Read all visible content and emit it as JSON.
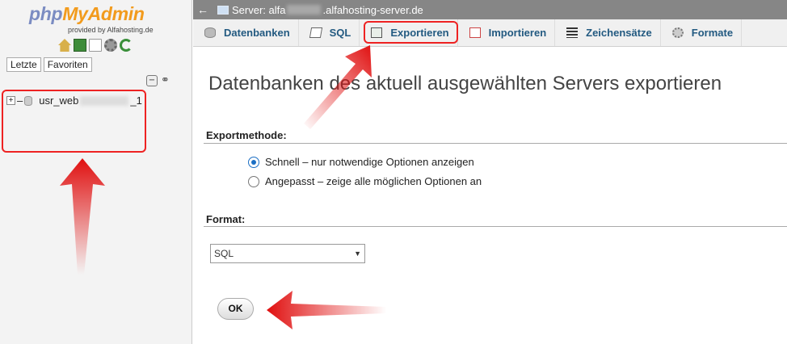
{
  "nav": {
    "logo_part1": "php",
    "logo_part2": "MyAdmin",
    "provided_by": "provided by Alfahosting.de",
    "icons": [
      "home-icon",
      "logout-icon",
      "docs-icon",
      "settings-icon",
      "reload-icon"
    ],
    "tabs": [
      "Letzte",
      "Favoriten"
    ],
    "tree": [
      {
        "prefix": "usr_web",
        "suffix": "_1"
      }
    ]
  },
  "topbar": {
    "prefix": "Server: alfa",
    "suffix": ".alfahosting-server.de"
  },
  "tabs": [
    {
      "label": "Datenbanken",
      "icon": "database-icon"
    },
    {
      "label": "SQL",
      "icon": "sql-icon"
    },
    {
      "label": "Exportieren",
      "icon": "export-icon",
      "active": true
    },
    {
      "label": "Importieren",
      "icon": "import-icon"
    },
    {
      "label": "Zeichensätze",
      "icon": "charset-icon"
    },
    {
      "label": "Formate",
      "icon": "formats-icon"
    }
  ],
  "main": {
    "title": "Datenbanken des aktuell ausgewählten Servers exportieren",
    "export_method_label": "Exportmethode:",
    "options": [
      {
        "label": "Schnell – nur notwendige Optionen anzeigen",
        "checked": true
      },
      {
        "label": "Angepasst – zeige alle möglichen Optionen an",
        "checked": false
      }
    ],
    "format_label": "Format:",
    "format_value": "SQL",
    "ok_label": "OK"
  },
  "colors": {
    "highlight": "#e02020",
    "tab_text": "#235a81",
    "topbar_bg": "#868686"
  }
}
